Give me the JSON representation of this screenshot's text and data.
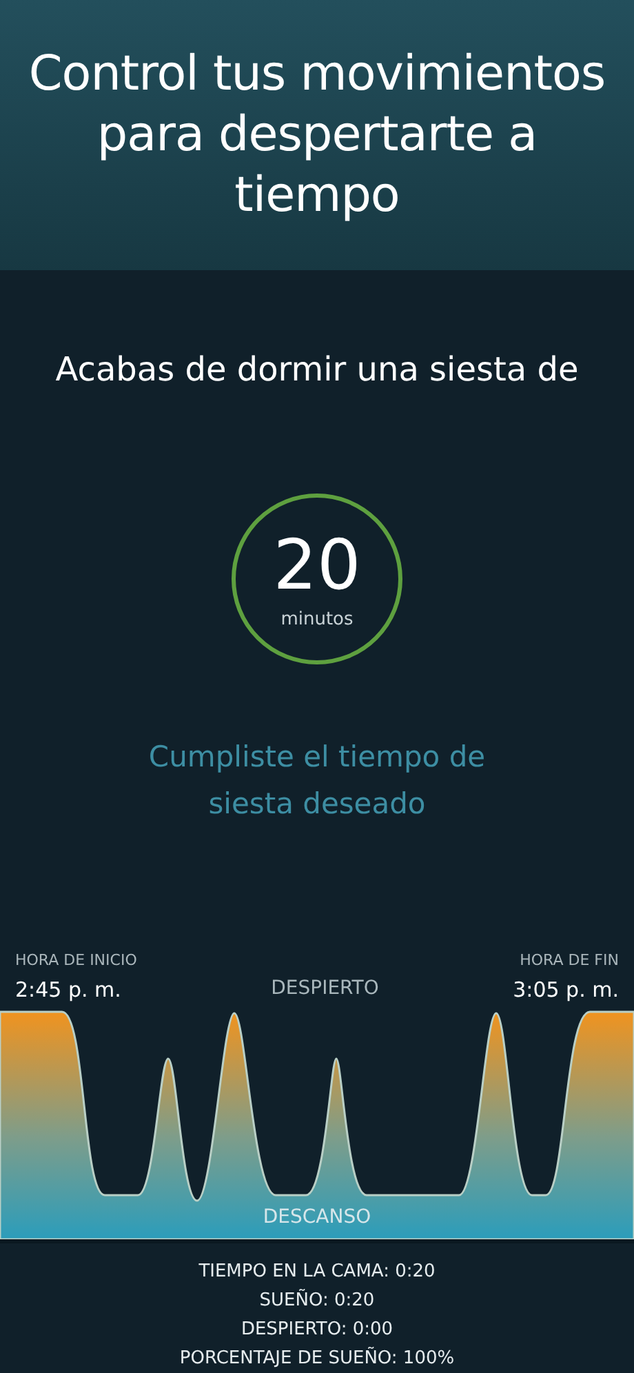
{
  "header": {
    "title": "Control tus movimientos para despertarte a tiempo"
  },
  "nap": {
    "intro": "Acabas de dormir una siesta de",
    "duration": "20",
    "unit": "minutos",
    "message": "Cumpliste el tiempo de siesta deseado"
  },
  "graph": {
    "start_label": "HORA DE INICIO",
    "start_time": "2:45 p. m.",
    "end_label": "HORA DE FIN",
    "end_time": "3:05 p. m.",
    "top_label": "DESPIERTO",
    "bottom_label": "DESCANSO"
  },
  "stats": [
    "TIEMPO EN LA CAMA: 0:20",
    "SUEÑO: 0:20",
    "DESPIERTO: 0:00",
    "PORCENTAJE DE SUEÑO: 100%"
  ]
}
